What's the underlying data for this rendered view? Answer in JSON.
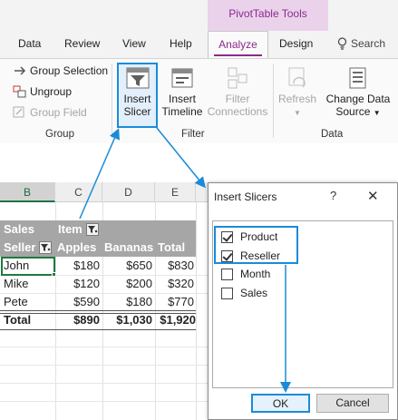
{
  "ribbon": {
    "context_tab_title": "PivotTable Tools",
    "tabs": [
      "Data",
      "Review",
      "View",
      "Help"
    ],
    "active_tab": "Analyze",
    "design_tab": "Design",
    "search_label": "Search",
    "group": {
      "group_selection": "Group Selection",
      "ungroup": "Ungroup",
      "group_field": "Group Field",
      "label": "Group"
    },
    "filter": {
      "insert_slicer_line1": "Insert",
      "insert_slicer_line2": "Slicer",
      "insert_timeline_line1": "Insert",
      "insert_timeline_line2": "Timeline",
      "filter_connections_line1": "Filter",
      "filter_connections_line2": "Connections",
      "label": "Filter"
    },
    "data": {
      "refresh": "Refresh",
      "change_source_line1": "Change Data",
      "change_source_line2": "Source",
      "label": "Data"
    }
  },
  "sheet": {
    "columns": [
      "B",
      "C",
      "D",
      "E"
    ],
    "pivot": {
      "header1": [
        "Sales",
        "Item"
      ],
      "header2": [
        "Seller",
        "Apples",
        "Bananas",
        "Total"
      ],
      "rows": [
        [
          "John",
          "$180",
          "$650",
          "$830"
        ],
        [
          "Mike",
          "$120",
          "$200",
          "$320"
        ],
        [
          "Pete",
          "$590",
          "$180",
          "$770"
        ]
      ],
      "total_row": [
        "Total",
        "$890",
        "$1,030",
        "$1,920"
      ]
    }
  },
  "dialog": {
    "title": "Insert Slicers",
    "help": "?",
    "close": "✕",
    "fields": [
      {
        "label": "Product",
        "checked": true
      },
      {
        "label": "Reseller",
        "checked": true
      },
      {
        "label": "Month",
        "checked": false
      },
      {
        "label": "Sales",
        "checked": false
      }
    ],
    "ok_label": "OK",
    "cancel_label": "Cancel"
  },
  "colors": {
    "accent_purple": "#8b2a8d",
    "highlight_blue": "#1a8bd9",
    "excel_green": "#1f7a3f",
    "pivot_header_gray": "#a6a6a6"
  }
}
